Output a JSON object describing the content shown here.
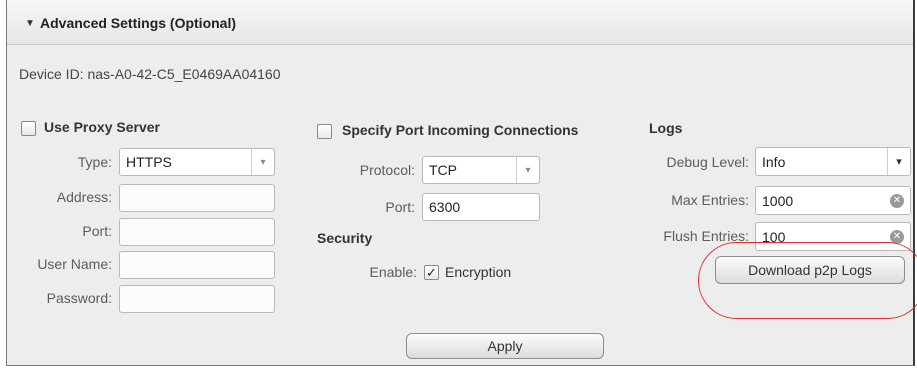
{
  "header": {
    "title": "Advanced Settings (Optional)"
  },
  "device": {
    "label": "Device ID:",
    "value": "nas-A0-42-C5_E0469AA04160"
  },
  "proxy": {
    "checkbox_label": "Use Proxy Server",
    "type_label": "Type:",
    "type_value": "HTTPS",
    "address_label": "Address:",
    "port_label": "Port:",
    "username_label": "User Name:",
    "password_label": "Password:"
  },
  "port_incoming": {
    "checkbox_label": "Specify Port Incoming Connections",
    "protocol_label": "Protocol:",
    "protocol_value": "TCP",
    "port_label": "Port:",
    "port_value": "6300"
  },
  "security": {
    "title": "Security",
    "enable_label": "Enable:",
    "encryption_label": "Encryption",
    "encryption_checked": true
  },
  "logs": {
    "title": "Logs",
    "debug_level_label": "Debug Level:",
    "debug_level_value": "Info",
    "max_entries_label": "Max Entries:",
    "max_entries_value": "1000",
    "flush_entries_label": "Flush Entries:",
    "flush_entries_value": "100",
    "download_button": "Download p2p Logs"
  },
  "actions": {
    "apply_button": "Apply"
  },
  "icons": {
    "collapse": "triangle-down-icon",
    "dropdown": "chevron-down-icon",
    "clear": "clear-icon",
    "check": "checkmark-icon"
  },
  "colors": {
    "highlight": "#d9302c",
    "panel_bg": "#ededed"
  }
}
